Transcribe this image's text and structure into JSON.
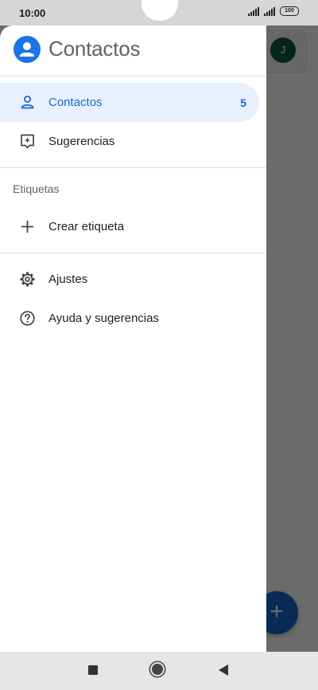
{
  "status_bar": {
    "time": "10:00",
    "battery": "100"
  },
  "background_app": {
    "avatar_letter": "J",
    "fab_symbol": "+"
  },
  "drawer": {
    "app_title": "Contactos",
    "primary_items": [
      {
        "label": "Contactos",
        "count": "5",
        "icon": "person-icon",
        "selected": true
      },
      {
        "label": "Sugerencias",
        "icon": "suggestions-icon",
        "selected": false
      }
    ],
    "labels_section": {
      "heading": "Etiquetas",
      "create_label": "Crear etiqueta"
    },
    "secondary_items": [
      {
        "label": "Ajustes",
        "icon": "gear-icon"
      },
      {
        "label": "Ayuda y sugerencias",
        "icon": "help-icon"
      }
    ]
  },
  "colors": {
    "accent": "#1a73e8",
    "selected_background": "#e8f0fe",
    "selected_text": "#1967d2",
    "scrim": "#000000"
  }
}
